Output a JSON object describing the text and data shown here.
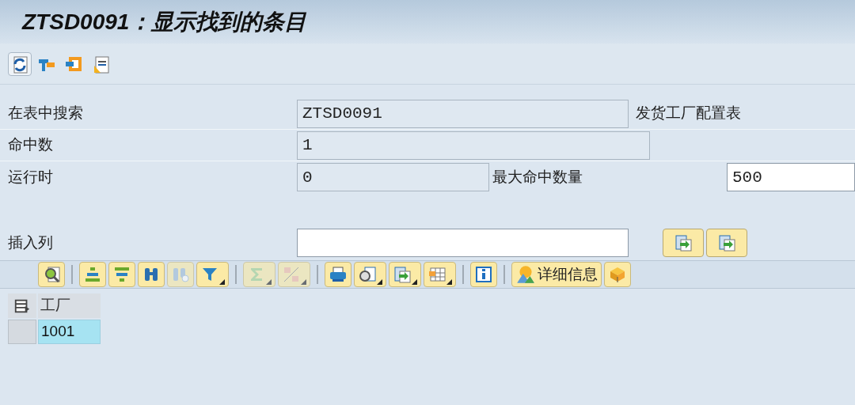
{
  "window": {
    "title": "ZTSD0091：显示找到的条目"
  },
  "form": {
    "rows": [
      {
        "label": "在表中搜索",
        "fields": [
          {
            "value": "ZTSD0091",
            "editable": false
          }
        ],
        "note": "发货工厂配置表"
      },
      {
        "label": "命中数",
        "fields": [
          {
            "value": "1",
            "editable": false
          }
        ]
      },
      {
        "label": "运行时",
        "fields": [
          {
            "value": "0",
            "editable": false
          }
        ],
        "label_2": "最大命中数量",
        "fields_2": [
          {
            "value": "500",
            "editable": true
          }
        ]
      },
      {
        "label": "插入列",
        "fields": [
          {
            "editable": true
          }
        ]
      }
    ]
  },
  "grid_toolbar": {
    "details_button": "详细信息"
  },
  "table": {
    "columns": [
      "工厂"
    ],
    "rows": [
      [
        "1001"
      ]
    ]
  }
}
